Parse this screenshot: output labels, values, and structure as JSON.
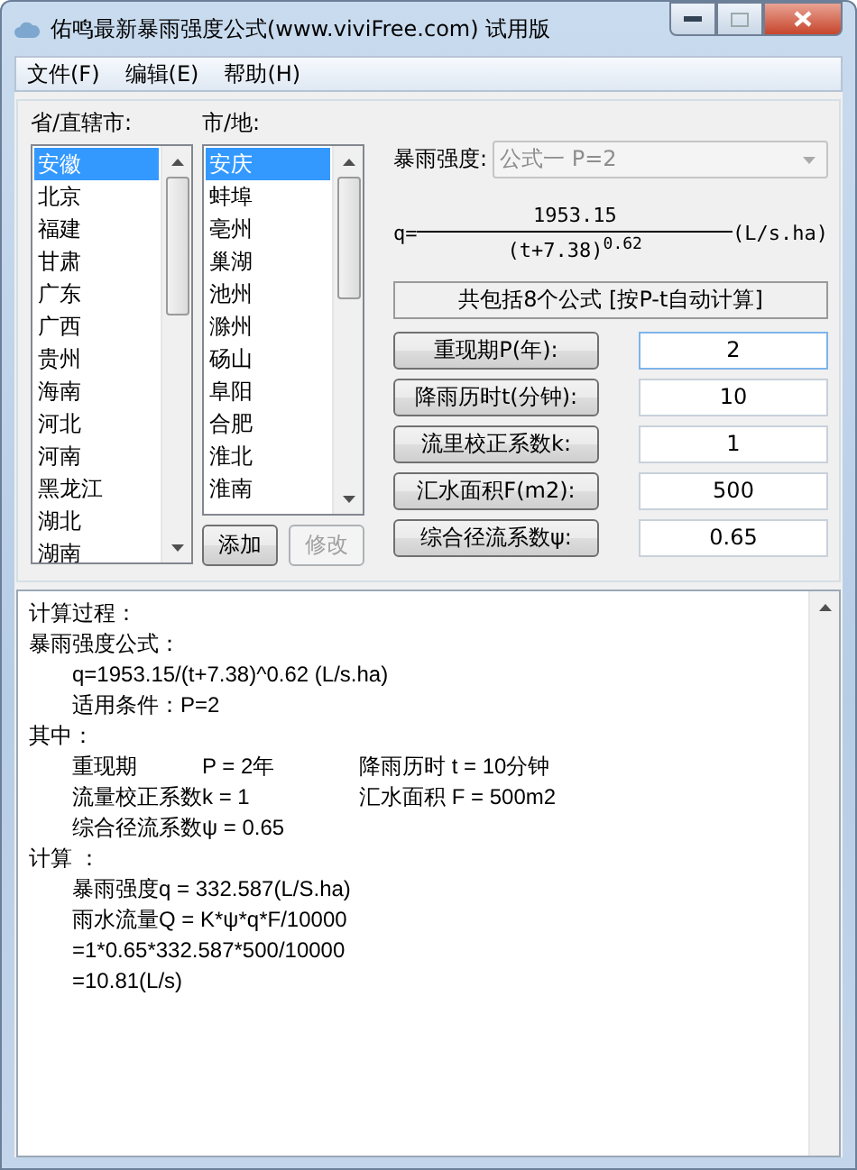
{
  "window": {
    "title": "佑鸣最新暴雨强度公式(www.viviFree.com) 试用版"
  },
  "menu": [
    "文件(F)",
    "编辑(E)",
    "帮助(H)"
  ],
  "provinces": {
    "label": "省/直辖市:",
    "items": [
      {
        "name": "安徽",
        "selected": true
      },
      {
        "name": "北京",
        "selected": false
      },
      {
        "name": "福建",
        "selected": false
      },
      {
        "name": "甘肃",
        "selected": false
      },
      {
        "name": "广东",
        "selected": false
      },
      {
        "name": "广西",
        "selected": false
      },
      {
        "name": "贵州",
        "selected": false
      },
      {
        "name": "海南",
        "selected": false
      },
      {
        "name": "河北",
        "selected": false
      },
      {
        "name": "河南",
        "selected": false
      },
      {
        "name": "黑龙江",
        "selected": false
      },
      {
        "name": "湖北",
        "selected": false
      },
      {
        "name": "湖南",
        "selected": false
      }
    ]
  },
  "cities": {
    "label": "市/地:",
    "items": [
      {
        "name": "安庆",
        "selected": true
      },
      {
        "name": "蚌埠",
        "selected": false
      },
      {
        "name": "亳州",
        "selected": false
      },
      {
        "name": "巢湖",
        "selected": false
      },
      {
        "name": "池州",
        "selected": false
      },
      {
        "name": "滁州",
        "selected": false
      },
      {
        "name": "砀山",
        "selected": false
      },
      {
        "name": "阜阳",
        "selected": false
      },
      {
        "name": "合肥",
        "selected": false
      },
      {
        "name": "淮北",
        "selected": false
      },
      {
        "name": "淮南",
        "selected": false
      }
    ]
  },
  "list_buttons": [
    {
      "label": "添加",
      "disabled": false
    },
    {
      "label": "修改",
      "disabled": true
    }
  ],
  "intensity": {
    "label": "暴雨强度:",
    "value": "公式一 P=2",
    "disabled": true
  },
  "formula": {
    "lhs": "q=",
    "numerator": "1953.15",
    "denominator": "(t+7.38)$^{0.62}$",
    "unit": "(L/s.ha)"
  },
  "summary_button": "共包括8个公式 [按P-t自动计算]",
  "params": [
    {
      "label": "重现期P(年):",
      "value": "2",
      "selected": true
    },
    {
      "label": "降雨历时t(分钟):",
      "value": "10",
      "selected": false
    },
    {
      "label": "流里校正系数k:",
      "value": "1",
      "selected": false
    },
    {
      "label": "汇水面积F(m2):",
      "value": "500",
      "selected": false
    },
    {
      "label": "综合径流系数ψ:",
      "value": "0.65",
      "selected": false
    }
  ],
  "result": [
    {
      "heading": "计算过程："
    },
    {
      "heading": "暴雨强度公式：",
      "lines": [
        [
          "q=1953.15/(t+7.38)^0.62 (L/s.ha)"
        ],
        [
          "适用条件：P=2"
        ]
      ]
    },
    {
      "heading": "其中：",
      "lines": [
        [
          "重现期",
          "P = 2年",
          "降雨历时 t = 10分钟"
        ],
        [
          "流量校正系数k = 1",
          "汇水面积 F = 500m2"
        ],
        [
          "综合径流系数ψ = 0.65"
        ]
      ]
    },
    {
      "heading": "计算 ：",
      "lines": [
        [
          "暴雨强度q = 332.587(L/S.ha)"
        ],
        [
          "雨水流量Q = K*ψ*q*F/10000"
        ],
        [
          "=1*0.65*332.587*500/10000"
        ],
        [
          "=10.81(L/s)"
        ]
      ]
    }
  ]
}
